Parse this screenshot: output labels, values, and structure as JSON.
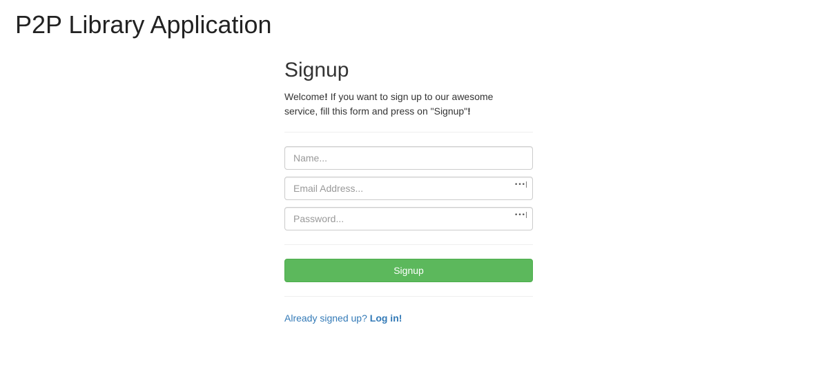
{
  "app": {
    "title": "P2P Library Application"
  },
  "signup_form": {
    "title": "Signup",
    "intro_welcome": "Welcome",
    "intro_bang1": "!",
    "intro_text": " If you want to sign up to our awesome service, fill this form and press on \"Signup\"",
    "intro_bang2": "!",
    "fields": {
      "name": {
        "placeholder": "Name...",
        "value": ""
      },
      "email": {
        "placeholder": "Email Address...",
        "value": "",
        "icon": "password-manager-key-icon"
      },
      "password": {
        "placeholder": "Password...",
        "value": "",
        "icon": "password-manager-key-icon"
      }
    },
    "submit_label": "Signup",
    "login_prompt": "Already signed up?",
    "login_link": "Log in!"
  },
  "colors": {
    "primary_button": "#5cb85c",
    "link": "#337ab7",
    "divider": "#eeeeee"
  }
}
